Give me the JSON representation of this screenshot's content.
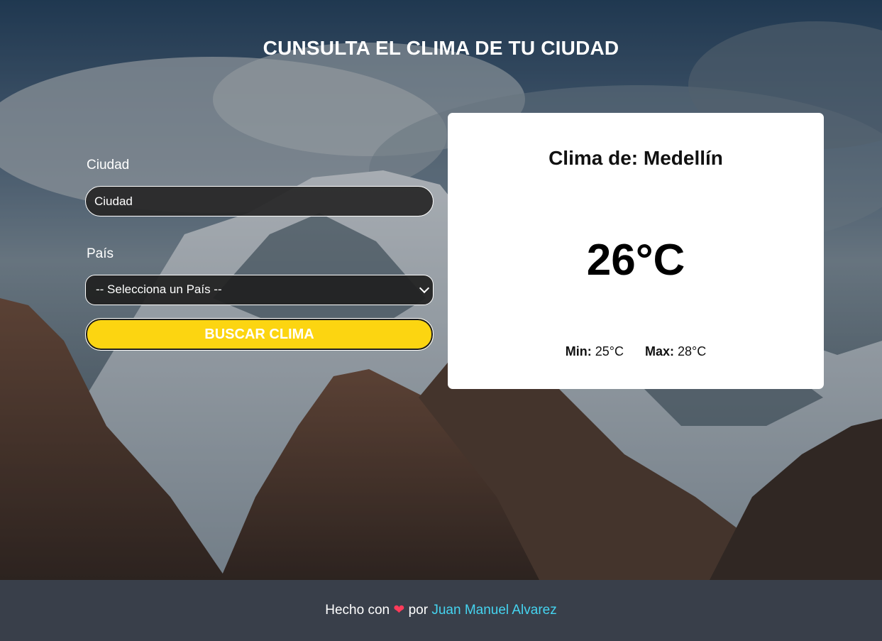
{
  "header": {
    "title": "CUNSULTA EL CLIMA DE TU CIUDAD"
  },
  "form": {
    "city_label": "Ciudad",
    "city_placeholder": "Ciudad",
    "city_value": "",
    "country_label": "País",
    "country_selected": "-- Selecciona un País --",
    "submit_label": "BUSCAR CLIMA"
  },
  "weather": {
    "title": "Clima de: Medellín",
    "temperature": "26°C",
    "min_label": "Min:",
    "min_value": "25°C",
    "max_label": "Max:",
    "max_value": "28°C"
  },
  "footer": {
    "prefix": "Hecho con",
    "heart_glyph": "❤",
    "middle": "por",
    "author": "Juan Manuel Alvarez"
  },
  "colors": {
    "button_yellow": "#fcd511",
    "footer_bg": "#393f4a",
    "author_link": "#45d4f0",
    "heart": "#ff3b5a"
  },
  "icons": {
    "select_arrow": "chevron-down-icon",
    "footer_heart": "heart-icon"
  }
}
